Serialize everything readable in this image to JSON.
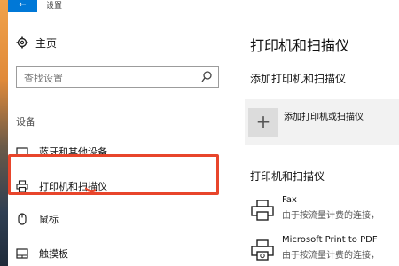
{
  "window": {
    "title": "设置",
    "back_glyph": "←"
  },
  "sidebar": {
    "home_label": "主页",
    "search_placeholder": "查找设置",
    "section_label": "设备",
    "items": [
      {
        "label": "蓝牙和其他设备"
      },
      {
        "label": "打印机和扫描仪",
        "selected": true
      },
      {
        "label": "鼠标"
      },
      {
        "label": "触摸板"
      }
    ]
  },
  "main": {
    "page_title": "打印机和扫描仪",
    "add_section_title": "添加打印机和扫描仪",
    "add_button_label": "添加打印机或扫描仪",
    "add_plus_glyph": "+",
    "list_section_title": "打印机和扫描仪",
    "printers": [
      {
        "name": "Fax",
        "status": "由于按流量计费的连接，"
      },
      {
        "name": "Microsoft Print to PDF",
        "status": "由于按流量计费的连接，"
      }
    ]
  },
  "colors": {
    "accent": "#0078d7",
    "highlight": "#e8452b"
  }
}
